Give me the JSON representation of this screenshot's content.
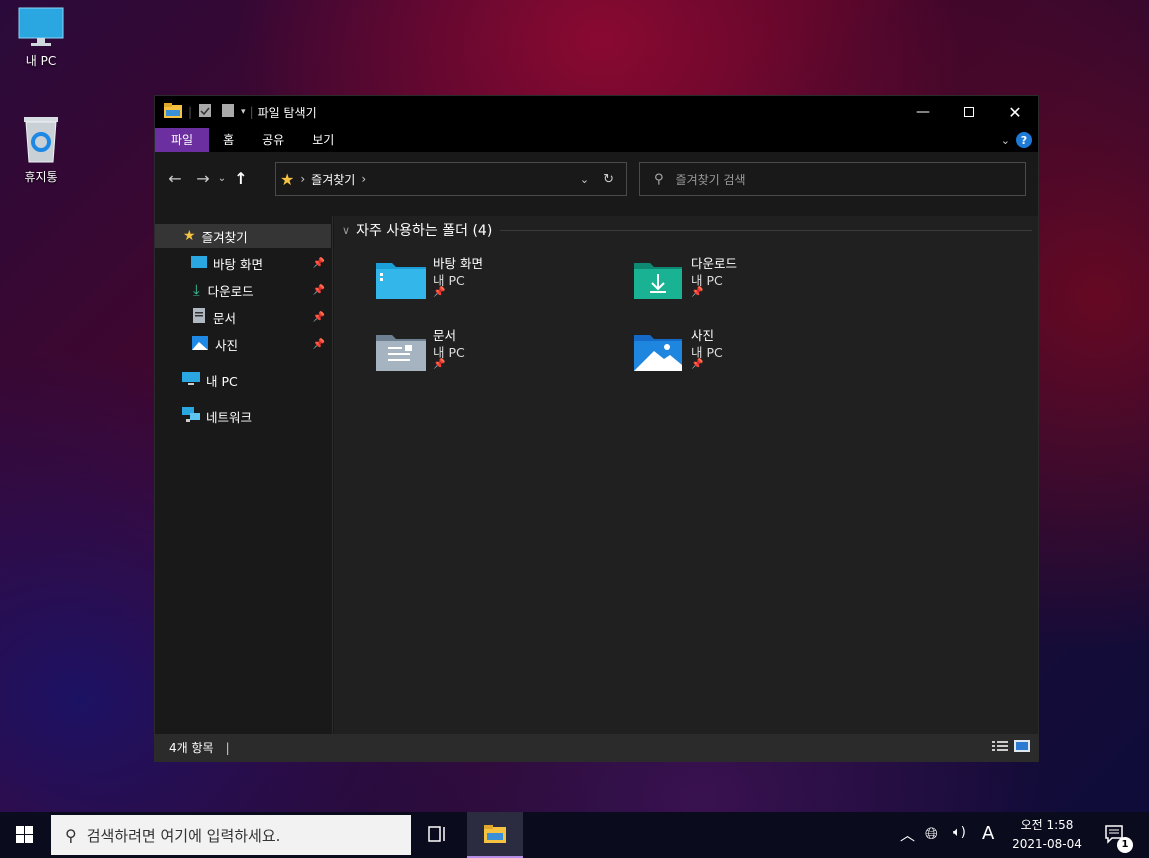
{
  "desktop": {
    "icons": [
      {
        "label": "내 PC",
        "icon": "monitor-icon"
      },
      {
        "label": "휴지통",
        "icon": "recycle-bin-icon"
      }
    ]
  },
  "window": {
    "title": "파일 탐색기",
    "ribbon_tabs": [
      "파일",
      "홈",
      "공유",
      "보기"
    ],
    "active_tab": "파일",
    "address_path": "즐겨찾기",
    "search_placeholder": "즐겨찾기 검색",
    "accent_color": "#6b2fa0",
    "nav": {
      "quick_access": "즐겨찾기",
      "items": [
        {
          "label": "바탕 화면",
          "pinned": true,
          "icon": "desktop-folder-icon"
        },
        {
          "label": "다운로드",
          "pinned": true,
          "icon": "download-icon"
        },
        {
          "label": "문서",
          "pinned": true,
          "icon": "document-icon"
        },
        {
          "label": "사진",
          "pinned": true,
          "icon": "pictures-icon"
        }
      ],
      "this_pc": "내 PC",
      "network": "네트워크"
    },
    "content": {
      "group_header": "자주 사용하는 폴더 (4)",
      "folders": [
        {
          "name": "바탕 화면",
          "location": "내 PC",
          "icon": "desktop-folder-icon"
        },
        {
          "name": "다운로드",
          "location": "내 PC",
          "icon": "downloads-folder-icon"
        },
        {
          "name": "문서",
          "location": "내 PC",
          "icon": "documents-folder-icon"
        },
        {
          "name": "사진",
          "location": "내 PC",
          "icon": "pictures-folder-icon"
        }
      ]
    },
    "status": "4개 항목"
  },
  "taskbar": {
    "search_placeholder": "검색하려면 여기에 입력하세요.",
    "time": "오전 1:58",
    "date": "2021-08-04",
    "ime": "A",
    "notification_count": "1"
  }
}
